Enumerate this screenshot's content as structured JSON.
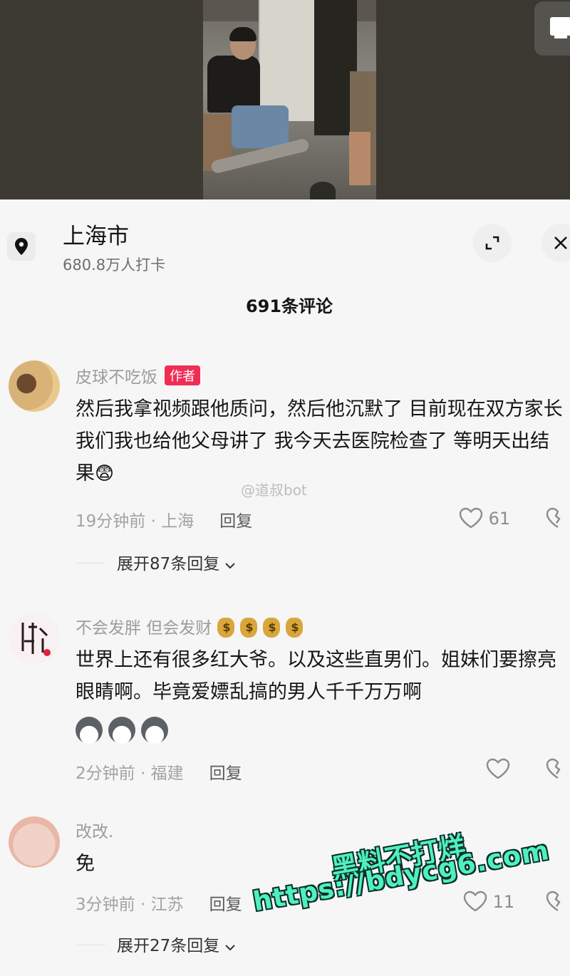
{
  "location": {
    "title": "上海市",
    "subtitle": "680.8万人打卡"
  },
  "comments_count": "691条评论",
  "comments": [
    {
      "user": "皮球不吃饭",
      "badge": "作者",
      "text": "然后我拿视频跟他质问，然后他沉默了 目前现在双方家长我们我也给他父母讲了 我今天去医院检查了 等明天出结果",
      "emoji": "😨",
      "time_location": "19分钟前 · 上海",
      "reply_label": "回复",
      "likes": "61",
      "expand_label": "展开87条回复"
    },
    {
      "user": "不会发胖 但会发财",
      "text": "世界上还有很多红大爷。以及这些直男们。姐妹们要擦亮眼睛啊。毕竟爱嫖乱搞的男人千千万万啊",
      "time_location": "2分钟前 · 福建",
      "reply_label": "回复"
    },
    {
      "user": "改改.",
      "text": "免",
      "time_location": "3分钟前 · 江苏",
      "reply_label": "回复",
      "likes": "11",
      "expand_label": "展开27条回复"
    }
  ],
  "watermark": "@道叔bot",
  "promo": {
    "line1": "黑料不打烊",
    "line2": "https://bdycg6.com"
  },
  "colors": {
    "author_badge": "#f02d55",
    "promo_text": "#4ff0c0"
  }
}
